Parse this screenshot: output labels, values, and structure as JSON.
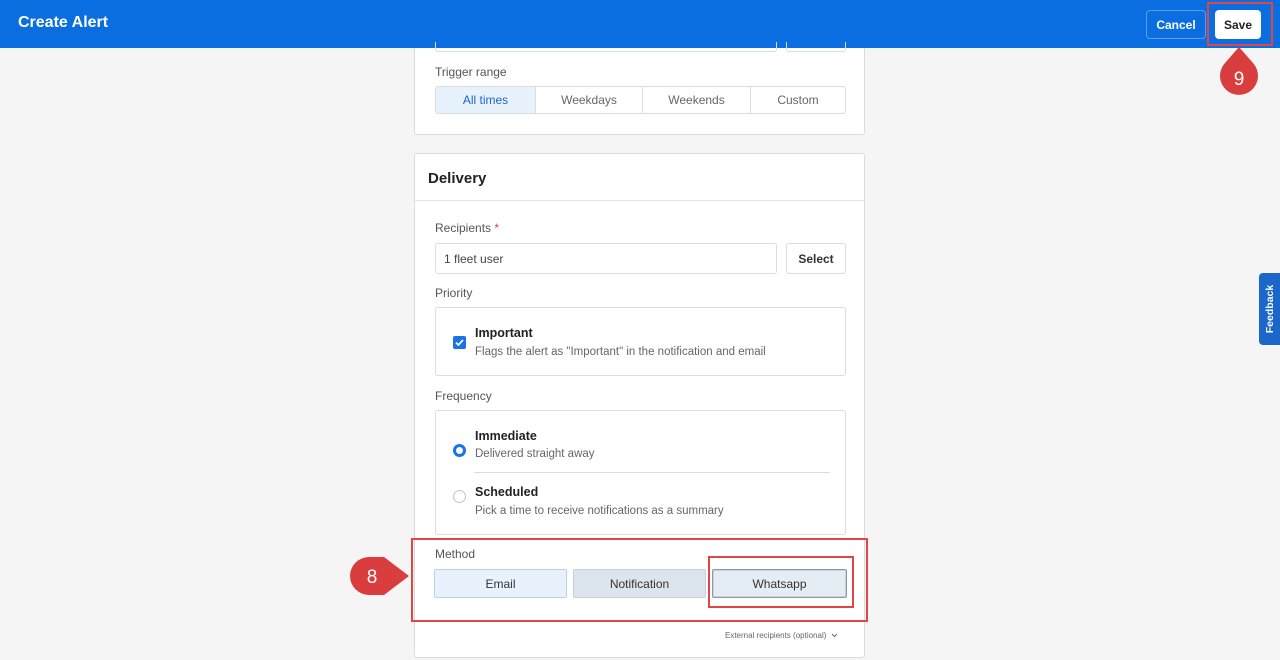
{
  "header": {
    "title": "Create Alert",
    "cancel_label": "Cancel",
    "save_label": "Save"
  },
  "trigger": {
    "label": "Trigger range",
    "options": [
      "All times",
      "Weekdays",
      "Weekends",
      "Custom"
    ],
    "selected": "All times"
  },
  "delivery": {
    "title": "Delivery",
    "recipients": {
      "label": "Recipients",
      "required_mark": "*",
      "value": "1 fleet user",
      "select_label": "Select"
    },
    "priority": {
      "label": "Priority",
      "option_title": "Important",
      "option_desc": "Flags the alert as \"Important\" in the notification and email",
      "checked": true
    },
    "frequency": {
      "label": "Frequency",
      "options": [
        {
          "title": "Immediate",
          "desc": "Delivered straight away",
          "selected": true
        },
        {
          "title": "Scheduled",
          "desc": "Pick a time to receive notifications as a summary",
          "selected": false
        }
      ]
    },
    "method": {
      "label": "Method",
      "options": [
        "Email",
        "Notification",
        "Whatsapp"
      ]
    },
    "external_label": "External recipients (optional)"
  },
  "annotations": {
    "step_8": "8",
    "step_9": "9",
    "highlight_color": "#e04646"
  },
  "feedback_label": "Feedback",
  "colors": {
    "primary": "#0a6ee0",
    "accent": "#1a73e8"
  }
}
